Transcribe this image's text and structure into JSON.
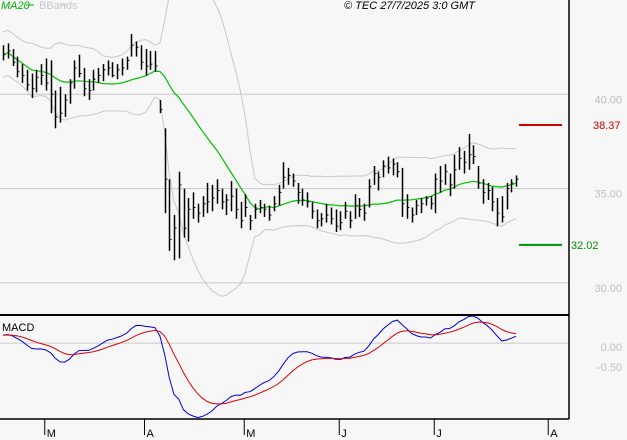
{
  "header": {
    "legend_ma": "MA20",
    "legend_bbands": "BBands",
    "copyright": "© TEC 27/7/2025 3:0 GMT"
  },
  "macd_panel": {
    "label": "MACD"
  },
  "colors": {
    "ma": "#00c000",
    "bbands": "#c8c8c8",
    "bars": "#000000",
    "resistance": "#cc0000",
    "support": "#009000",
    "macd": "#0000dd",
    "signal": "#dd0000",
    "grid": "#c8c8c8"
  },
  "chart_data": {
    "type": "ohlc",
    "title": "",
    "price_axis": {
      "ticks": [
        40,
        35,
        30
      ],
      "tick_labels": [
        "40.00",
        "35.00",
        "30.00"
      ],
      "range": [
        28.3,
        45.0
      ]
    },
    "macd_axis": {
      "ticks": [
        0,
        -0.5
      ],
      "tick_labels": [
        "0.00",
        "-0.50"
      ],
      "range": [
        -1.9,
        0.68
      ]
    },
    "months": [
      "M",
      "A",
      "M",
      "J",
      "J",
      "A"
    ],
    "month_bar_index": [
      9,
      30,
      51,
      71,
      91,
      115
    ],
    "total_slots": 119,
    "resistance": {
      "value": 38.37,
      "label": "38.37"
    },
    "support": {
      "value": 32.02,
      "label": "32.02"
    },
    "indicators": {
      "ma_period": 20,
      "bb_k": 2,
      "macd": [
        12,
        26,
        9
      ]
    },
    "bars_hlc": [
      [
        42.6,
        41.8,
        42.1
      ],
      [
        42.7,
        41.9,
        42.3
      ],
      [
        42.4,
        41.5,
        41.7
      ],
      [
        42.0,
        40.9,
        41.2
      ],
      [
        41.6,
        40.6,
        41.0
      ],
      [
        41.3,
        40.2,
        40.5
      ],
      [
        41.1,
        39.8,
        40.3
      ],
      [
        41.3,
        40.1,
        40.9
      ],
      [
        41.6,
        40.5,
        41.0
      ],
      [
        41.9,
        40.2,
        40.6
      ],
      [
        41.8,
        39.0,
        40.0
      ],
      [
        40.2,
        38.2,
        38.8
      ],
      [
        40.4,
        38.5,
        39.0
      ],
      [
        40.0,
        38.8,
        39.7
      ],
      [
        40.8,
        39.5,
        40.6
      ],
      [
        41.8,
        40.3,
        41.4
      ],
      [
        42.1,
        40.9,
        41.1
      ],
      [
        41.4,
        39.9,
        40.3
      ],
      [
        40.8,
        39.7,
        40.2
      ],
      [
        41.3,
        40.2,
        40.8
      ],
      [
        41.4,
        40.6,
        41.0
      ],
      [
        41.6,
        40.7,
        41.3
      ],
      [
        41.8,
        41.0,
        41.4
      ],
      [
        41.7,
        40.9,
        41.0
      ],
      [
        41.6,
        40.8,
        41.3
      ],
      [
        41.9,
        41.0,
        41.4
      ],
      [
        42.0,
        41.3,
        41.8
      ],
      [
        43.2,
        42.0,
        42.6
      ],
      [
        42.8,
        42.0,
        42.5
      ],
      [
        42.6,
        41.3,
        41.7
      ],
      [
        42.4,
        41.0,
        41.5
      ],
      [
        42.3,
        41.3,
        41.6
      ],
      [
        42.3,
        41.2,
        41.5
      ],
      [
        39.7,
        39.0,
        39.2
      ],
      [
        38.2,
        33.7,
        35.5
      ],
      [
        35.5,
        31.7,
        32.3
      ],
      [
        33.6,
        31.2,
        32.9
      ],
      [
        35.9,
        31.3,
        35.2
      ],
      [
        35.0,
        32.4,
        32.9
      ],
      [
        34.5,
        32.2,
        33.9
      ],
      [
        34.8,
        33.4,
        34.0
      ],
      [
        34.2,
        33.2,
        33.7
      ],
      [
        34.6,
        33.5,
        34.2
      ],
      [
        35.3,
        33.7,
        34.3
      ],
      [
        35.2,
        33.8,
        34.5
      ],
      [
        35.5,
        34.2,
        34.9
      ],
      [
        35.0,
        33.9,
        34.3
      ],
      [
        34.7,
        33.6,
        34.4
      ],
      [
        35.4,
        33.8,
        34.6
      ],
      [
        35.0,
        33.4,
        33.9
      ],
      [
        34.3,
        32.9,
        33.3
      ],
      [
        34.7,
        33.5,
        34.0
      ],
      [
        33.6,
        32.8,
        33.3
      ],
      [
        34.2,
        33.4,
        33.9
      ],
      [
        34.4,
        33.7,
        34.0
      ],
      [
        34.2,
        33.5,
        33.9
      ],
      [
        34.1,
        33.3,
        33.6
      ],
      [
        34.6,
        33.8,
        34.2
      ],
      [
        35.2,
        34.1,
        34.8
      ],
      [
        36.4,
        35.0,
        35.6
      ],
      [
        36.1,
        35.2,
        35.7
      ],
      [
        35.8,
        35.1,
        35.4
      ],
      [
        35.3,
        34.2,
        34.8
      ],
      [
        35.0,
        34.1,
        34.4
      ],
      [
        34.8,
        34.0,
        34.3
      ],
      [
        34.3,
        33.4,
        33.8
      ],
      [
        33.9,
        32.9,
        33.3
      ],
      [
        33.7,
        33.0,
        33.4
      ],
      [
        34.2,
        33.2,
        33.6
      ],
      [
        34.0,
        33.1,
        33.4
      ],
      [
        33.9,
        32.7,
        33.0
      ],
      [
        33.8,
        32.8,
        33.2
      ],
      [
        34.3,
        33.4,
        33.8
      ],
      [
        33.8,
        32.9,
        33.3
      ],
      [
        34.7,
        33.4,
        34.1
      ],
      [
        34.5,
        33.5,
        33.9
      ],
      [
        34.2,
        33.3,
        33.7
      ],
      [
        35.5,
        34.0,
        35.1
      ],
      [
        36.2,
        35.2,
        35.8
      ],
      [
        35.9,
        34.9,
        35.6
      ],
      [
        36.5,
        35.6,
        36.2
      ],
      [
        36.7,
        35.8,
        36.1
      ],
      [
        36.6,
        35.7,
        36.3
      ],
      [
        36.4,
        35.6,
        35.9
      ],
      [
        36.1,
        33.5,
        34.2
      ],
      [
        34.7,
        33.4,
        34.0
      ],
      [
        34.0,
        33.2,
        33.6
      ],
      [
        34.4,
        33.6,
        34.1
      ],
      [
        34.5,
        33.7,
        34.2
      ],
      [
        34.6,
        34.1,
        34.5
      ],
      [
        34.6,
        33.9,
        34.2
      ],
      [
        35.8,
        33.7,
        35.5
      ],
      [
        36.2,
        34.8,
        35.4
      ],
      [
        36.3,
        35.2,
        35.9
      ],
      [
        35.8,
        34.6,
        35.2
      ],
      [
        36.8,
        35.0,
        36.0
      ],
      [
        37.2,
        36.0,
        36.6
      ],
      [
        37.0,
        35.8,
        36.4
      ],
      [
        37.9,
        36.0,
        36.8
      ],
      [
        37.3,
        36.3,
        36.7
      ],
      [
        36.2,
        35.0,
        35.3
      ],
      [
        35.5,
        34.2,
        34.8
      ],
      [
        35.3,
        34.4,
        34.9
      ],
      [
        35.1,
        33.8,
        34.3
      ],
      [
        34.5,
        33.0,
        33.7
      ],
      [
        34.6,
        33.2,
        33.5
      ],
      [
        35.3,
        33.9,
        35.0
      ],
      [
        35.5,
        34.8,
        35.3
      ],
      [
        35.7,
        35.1,
        35.5
      ]
    ]
  }
}
